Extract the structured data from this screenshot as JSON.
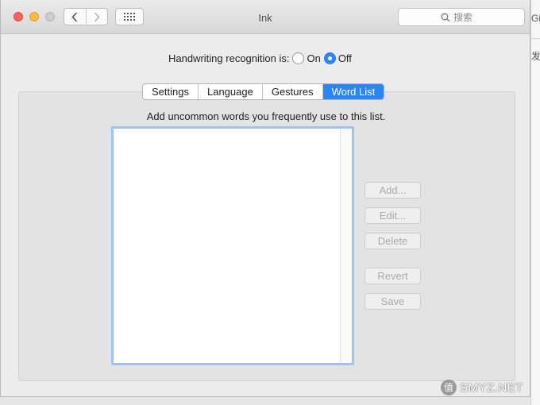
{
  "background_app": {
    "fragment_top": "Gi",
    "fragment_mid": "发"
  },
  "window": {
    "title": "Ink",
    "search_placeholder": "搜索",
    "icons": {
      "back": "chevron-left-icon",
      "forward": "chevron-right-icon",
      "show_all": "grid-icon",
      "search": "search-icon"
    }
  },
  "recognition": {
    "label": "Handwriting recognition is:",
    "on_label": "On",
    "off_label": "Off",
    "selected": "Off"
  },
  "tabs": [
    {
      "label": "Settings",
      "selected": false
    },
    {
      "label": "Language",
      "selected": false
    },
    {
      "label": "Gestures",
      "selected": false
    },
    {
      "label": "Word List",
      "selected": true
    }
  ],
  "word_list": {
    "hint": "Add uncommon words you frequently use to this list.",
    "buttons": {
      "add": "Add...",
      "edit": "Edit...",
      "delete": "Delete",
      "revert": "Revert",
      "save": "Save"
    }
  },
  "watermark": {
    "badge": "值",
    "text": "SMYZ.NET"
  },
  "colors": {
    "accent": "#2a86f5",
    "close": "#fc615d",
    "minimize": "#fdbc40",
    "list_focus": "#9fc3ee"
  }
}
